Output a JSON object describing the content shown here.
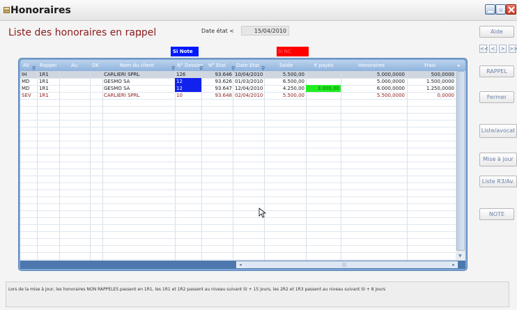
{
  "window": {
    "title": "Honoraires"
  },
  "header": {
    "title": "Liste des honoraires en rappel",
    "colon": ":",
    "date_label": "Date état <",
    "date_value": "15/04/2010"
  },
  "badges": {
    "si_note": "Si Note",
    "si_nc": "Si NC"
  },
  "grid": {
    "columns": [
      "AV",
      "Rappel",
      "Au",
      "OK",
      "Nom du client",
      "N° Dossier",
      "N° Etat",
      "Date Etat",
      "Solde",
      "€ payés",
      "Honoraires",
      "Frais"
    ],
    "rows": [
      {
        "av": "IH",
        "rappel": "1R1",
        "au": "",
        "ok": "",
        "client": "CARLIERI SPRL",
        "dossier": "126",
        "etat": "93.646",
        "date": "10/04/2010",
        "solde": "5.500,00",
        "payes": "",
        "honoraires": "5.000,0000",
        "frais": "500,0000"
      },
      {
        "av": "MD",
        "rappel": "1R1",
        "au": "",
        "ok": "",
        "client": "GESMO SA",
        "dossier": "12",
        "etat": "93.626",
        "date": "01/03/2010",
        "solde": "6.500,00",
        "payes": "",
        "honoraires": "5.000,0000",
        "frais": "1.500,0000"
      },
      {
        "av": "MD",
        "rappel": "1R1",
        "au": "",
        "ok": "",
        "client": "GESMO SA",
        "dossier": "12",
        "etat": "93.647",
        "date": "12/04/2010",
        "solde": "4.250,00",
        "payes": "3.000,00",
        "honoraires": "6.000,0000",
        "frais": "1.250,0000"
      },
      {
        "av": "SEV",
        "rappel": "1R1",
        "au": "",
        "ok": "",
        "client": "CARLIERI SPRL",
        "dossier": "10",
        "etat": "93.648",
        "date": "02/04/2010",
        "solde": "5.500,00",
        "payes": "",
        "honoraires": "5.500,0000",
        "frais": "0,0000"
      }
    ]
  },
  "side_buttons": {
    "aide": "Aide",
    "nav": [
      "<<",
      "<",
      ">",
      ">>"
    ],
    "rappel": "RAPPEL",
    "fermer": "Fermer",
    "liste_avocat": "Liste/avocat",
    "mise_a_jour": "Mise à jour",
    "liste_r3": "Liste R3/Av.",
    "note": "NOTE"
  },
  "status": {
    "text": "Lors de la mise à jour, les honoraires NON RAPPELES passent en 1R1, les 1R1 et 1R2  passent au niveau suivant SI + 15 jours,  les 2R2 et 1R3  passent au niveau suivant SI + 8 jours"
  },
  "colors": {
    "title": "#8b1a1a",
    "grid_header": "#8fb3de",
    "note_blue": "#0019ff",
    "nc_red": "#ff0000",
    "paid_green": "#22ee22"
  }
}
